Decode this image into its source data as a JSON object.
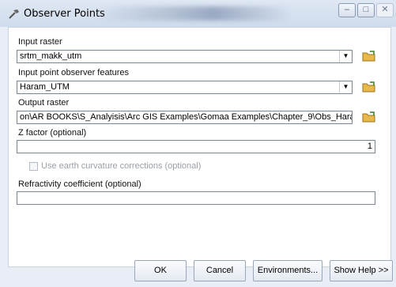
{
  "window": {
    "title": "Observer Points",
    "controls": {
      "minimize": "–",
      "maximize": "□",
      "close": "✕"
    }
  },
  "form": {
    "input_raster": {
      "label": "Input raster",
      "value": "srtm_makk_utm"
    },
    "observer_features": {
      "label": "Input point observer features",
      "value": "Haram_UTM"
    },
    "output_raster": {
      "label": "Output raster",
      "value": "on\\AR BOOKS\\S_Analyisis\\Arc GIS Examples\\Gomaa Examples\\Chapter_9\\Obs_Haram"
    },
    "z_factor": {
      "label": "Z factor (optional)",
      "value": "1"
    },
    "earth_curvature": {
      "label": "Use earth curvature corrections (optional)",
      "checked": false
    },
    "refractivity": {
      "label": "Refractivity coefficient (optional)",
      "value": ""
    }
  },
  "buttons": {
    "ok": "OK",
    "cancel": "Cancel",
    "environments": "Environments...",
    "show_help": "Show Help >>"
  },
  "colors": {
    "frame": "#e9eef6",
    "panel": "#ffffff",
    "folder": "#e8b94a"
  }
}
